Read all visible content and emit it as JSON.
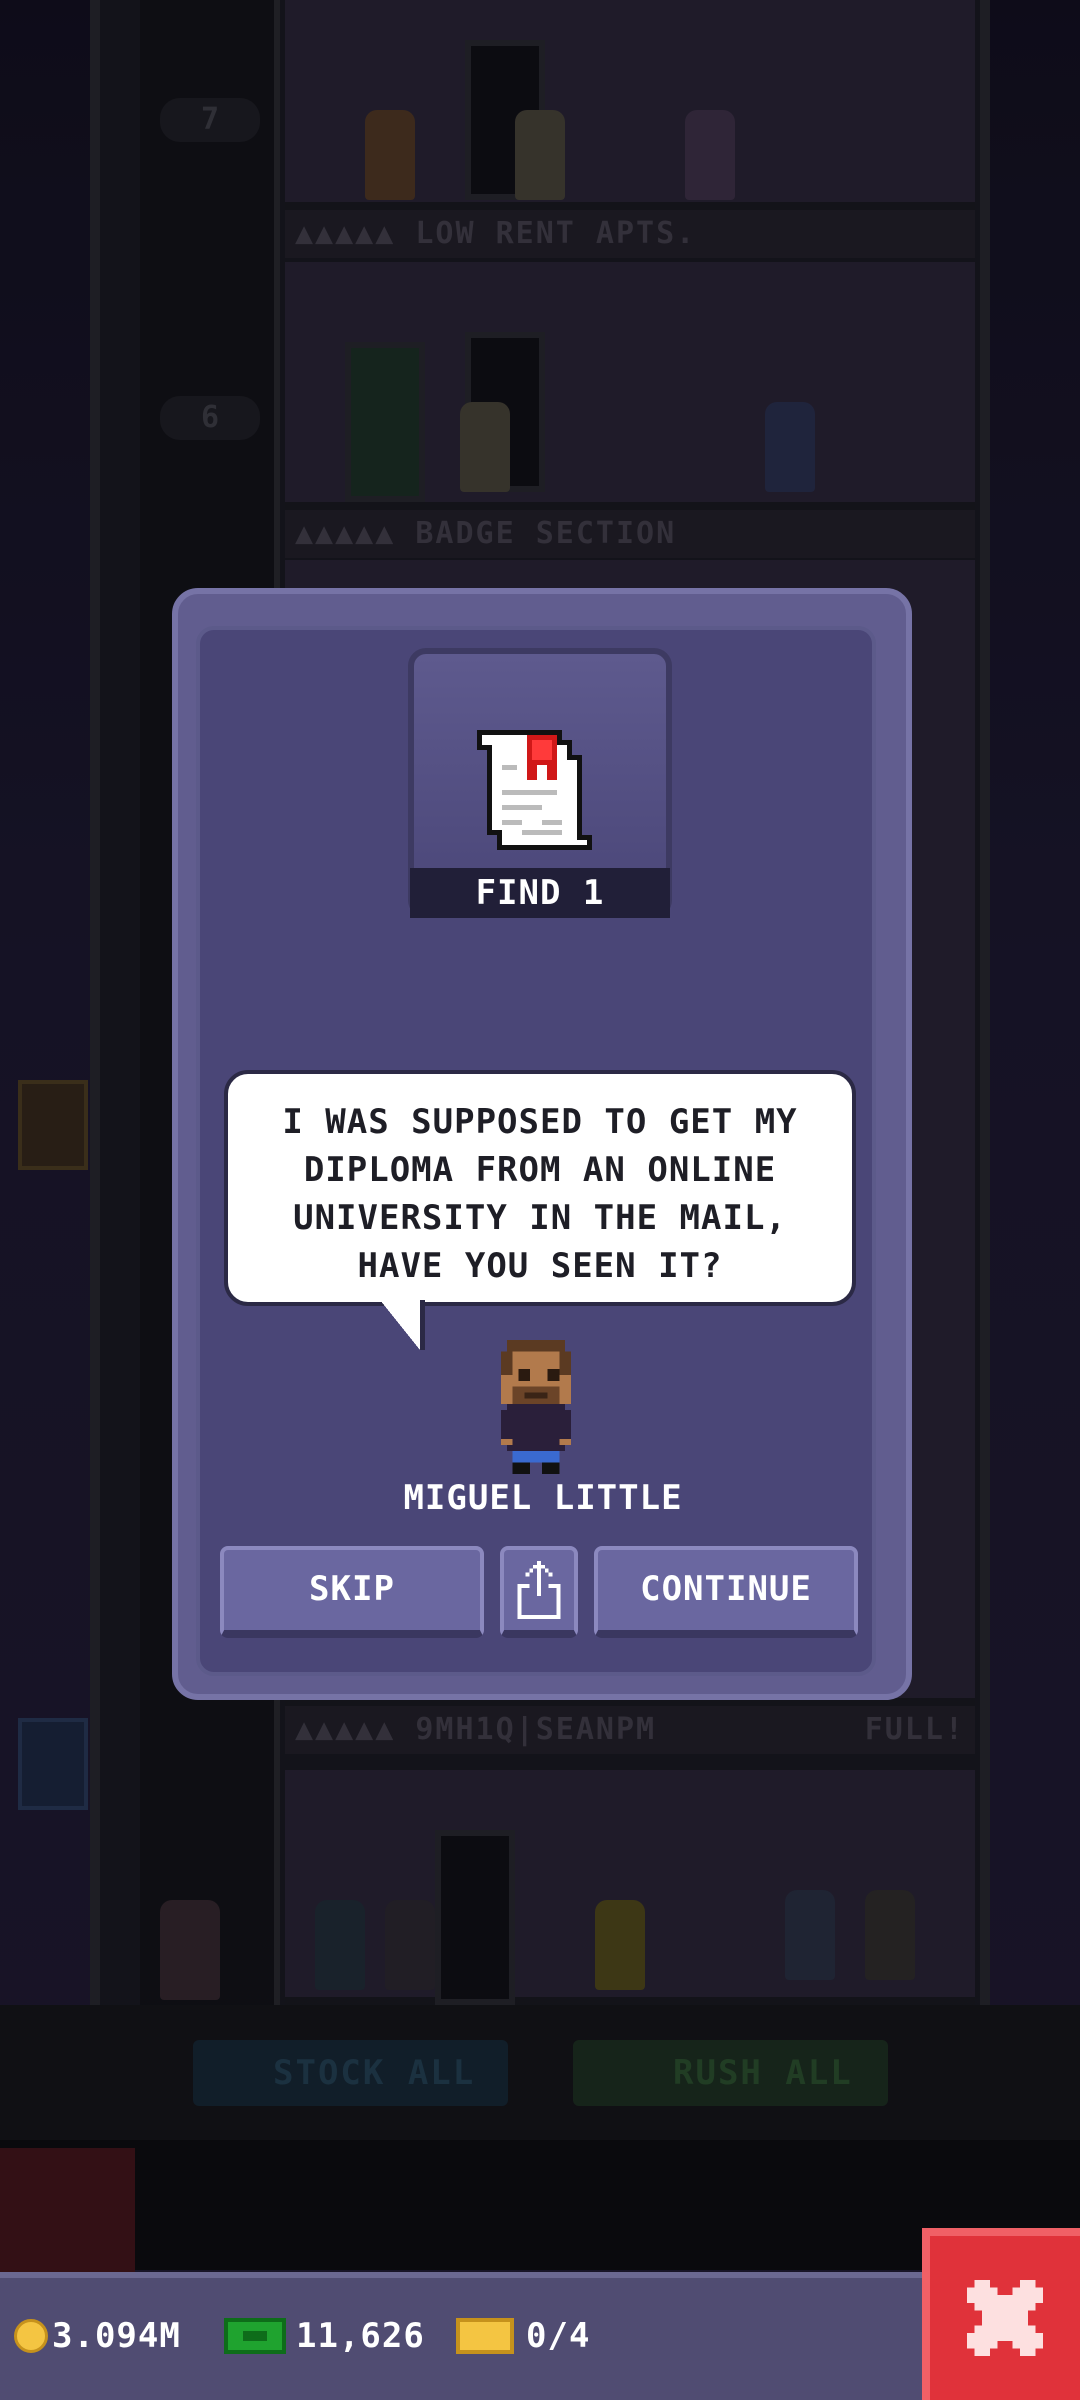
{
  "background": {
    "elevator_floor_numbers": [
      "7",
      "6"
    ],
    "floor_labels": [
      {
        "text": "▲▲▲▲▲ LOW RENT APTS.",
        "status": ""
      },
      {
        "text": "▲▲▲▲▲ BADGE SECTION",
        "status": ""
      },
      {
        "text": "▲▲▲▲▲ 9MH1Q|SEANPM",
        "status": "FULL!"
      }
    ],
    "stock_all_label": "STOCK ALL",
    "rush_all_label": "RUSH ALL"
  },
  "modal": {
    "item_caption": "FIND 1",
    "item_icon": "diploma-scroll-icon",
    "speech_lines": [
      "I WAS SUPPOSED TO GET MY",
      "DIPLOMA FROM AN ONLINE",
      "UNIVERSITY IN THE MAIL,",
      "HAVE YOU SEEN IT?"
    ],
    "character_name": "MIGUEL LITTLE",
    "skip_label": "SKIP",
    "share_icon": "share-icon",
    "continue_label": "CONTINUE"
  },
  "status_bar": {
    "coins": "3.094M",
    "bux": "11,626",
    "tickets": "0/4"
  },
  "colors": {
    "modal_bg": "#4a4677",
    "button": "#6a67a0",
    "close_button": "#e0323a",
    "status_bar": "#504c72"
  }
}
